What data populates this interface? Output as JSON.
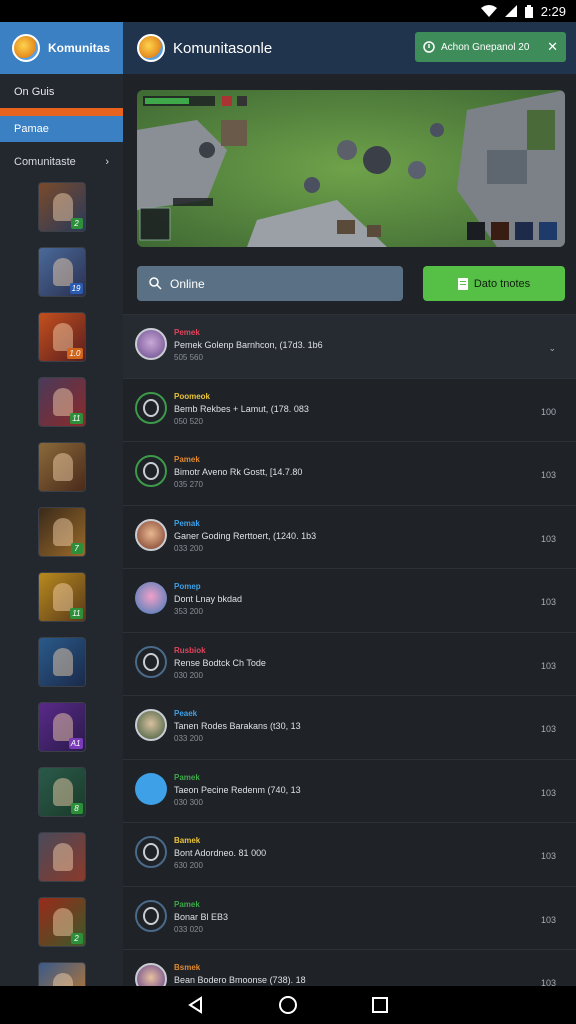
{
  "status_bar": {
    "time": "2:29"
  },
  "sidebar": {
    "app_name": "Komunitas",
    "section_label": "On Guis",
    "active_item": "Pamae",
    "collections_label": "Comunitaste",
    "champions": [
      {
        "icon": "warrior-portrait",
        "badge": "2",
        "badge_color": "#2e8f3a"
      },
      {
        "icon": "mage-portrait",
        "badge": "19",
        "badge_color": "#2a5bb0"
      },
      {
        "icon": "fire-knight-portrait",
        "badge": "1.0",
        "badge_color": "#d0661c"
      },
      {
        "icon": "gunner-portrait",
        "badge": "11",
        "badge_color": "#2e8f3a"
      },
      {
        "icon": "sorceress-portrait",
        "badge": "",
        "badge_color": ""
      },
      {
        "icon": "goblin-portrait",
        "badge": "7",
        "badge_color": "#2e8f3a"
      },
      {
        "icon": "golden-sun-portrait",
        "badge": "11",
        "badge_color": "#2e8f3a"
      },
      {
        "icon": "ice-dragon-portrait",
        "badge": "",
        "badge_color": ""
      },
      {
        "icon": "shadow-assassin-portrait",
        "badge": "A1",
        "badge_color": "#7a3bb8"
      },
      {
        "icon": "ranger-portrait",
        "badge": "8",
        "badge_color": "#2e8f3a"
      },
      {
        "icon": "robot-portrait",
        "badge": "",
        "badge_color": ""
      },
      {
        "icon": "red-dragon-portrait",
        "badge": "2",
        "badge_color": "#2e8f3a"
      },
      {
        "icon": "witch-portrait",
        "badge": "",
        "badge_color": ""
      }
    ]
  },
  "header": {
    "title": "Komunitasonle",
    "notification": "Achon Gnepanol 20"
  },
  "actions": {
    "search_label": "Online",
    "data_label": "Dato tnotes"
  },
  "list": [
    {
      "status": "Pemek",
      "status_color": "#e0445a",
      "title": "Pemek Golenp Barnhcon, (17d3. 1b6",
      "sub": "505 560",
      "right": "⌄",
      "avatar": "elf-face",
      "ring": "#c9cdd3"
    },
    {
      "status": "Poomeok",
      "status_color": "#e9c53a",
      "title": "Bemb Rekbes + Lamut, (178. 083",
      "sub": "050 520",
      "right": "100",
      "avatar": "ring",
      "ring": "#3c9a48"
    },
    {
      "status": "Pamek",
      "status_color": "#e08a2e",
      "title": "Bimotr Aveno Rk Gostt, [14.7.80",
      "sub": "035 270",
      "right": "103",
      "avatar": "ring",
      "ring": "#3c9a48"
    },
    {
      "status": "Pemak",
      "status_color": "#3ea0e6",
      "title": "Ganer Goding Rerttoert, (1240. 1b3",
      "sub": "033 200",
      "right": "103",
      "avatar": "hero-face",
      "ring": "#c9cdd3"
    },
    {
      "status": "Pomep",
      "status_color": "#3ea0e6",
      "title": "Dont Lnay bkdad",
      "sub": "353 200",
      "right": "103",
      "avatar": "pink-hair",
      "ring": "none"
    },
    {
      "status": "Rusbiok",
      "status_color": "#e0445a",
      "title": "Rense Bodtck Ch Tode",
      "sub": "030 200",
      "right": "103",
      "avatar": "ring",
      "ring": "#4a6a8a"
    },
    {
      "status": "Peaek",
      "status_color": "#3ea0e6",
      "title": "Tanen Rodes Barakans (t30, 13",
      "sub": "033 200",
      "right": "103",
      "avatar": "green-face",
      "ring": "#c9cdd3"
    },
    {
      "status": "Pamek",
      "status_color": "#3ea84a",
      "title": "Taeon Pecine Redenm (740, 13",
      "sub": "030 300",
      "right": "103",
      "avatar": "blue-icon",
      "ring": "none"
    },
    {
      "status": "Bamek",
      "status_color": "#e9c53a",
      "title": "Bont Adordneo. 81 000",
      "sub": "630 200",
      "right": "103",
      "avatar": "ring",
      "ring": "#4a6a8a"
    },
    {
      "status": "Pamek",
      "status_color": "#3ea84a",
      "title": "Bonar Bl EB3",
      "sub": "033 020",
      "right": "103",
      "avatar": "ring",
      "ring": "#4a6a8a"
    },
    {
      "status": "Bsmek",
      "status_color": "#e08a2e",
      "title": "Bean Bodero Bmoonse (738). 18",
      "sub": "030 300",
      "right": "103",
      "avatar": "mage-face",
      "ring": "#c9cdd3"
    }
  ]
}
